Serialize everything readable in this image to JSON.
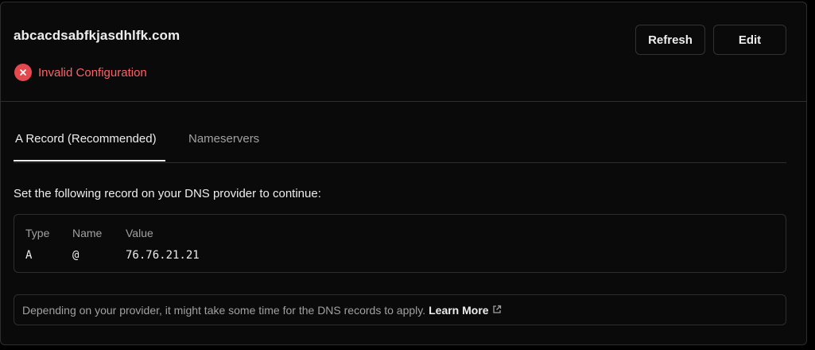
{
  "domain": {
    "name": "abcacdsabfkjasdhlfk.com",
    "status_text": "Invalid Configuration",
    "status_icon": "x-circle-icon",
    "status_color": "#e5484d"
  },
  "actions": {
    "refresh_label": "Refresh",
    "edit_label": "Edit"
  },
  "tabs": [
    {
      "label": "A Record (Recommended)",
      "active": true
    },
    {
      "label": "Nameservers",
      "active": false
    }
  ],
  "instruction": "Set the following record on your DNS provider to continue:",
  "record": {
    "headers": [
      "Type",
      "Name",
      "Value"
    ],
    "values": [
      "A",
      "@",
      "76.76.21.21"
    ]
  },
  "note": {
    "text": "Depending on your provider, it might take some time for the DNS records to apply.",
    "link_label": "Learn More",
    "link_icon": "external-link-icon"
  }
}
